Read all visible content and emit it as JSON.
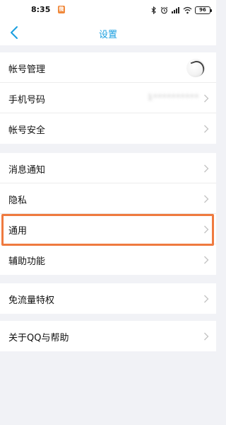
{
  "status_bar": {
    "time": "8:35",
    "app_badge_icon": "notification-app-icon",
    "icons": [
      "bluetooth-icon",
      "alarm-icon",
      "signal-icon",
      "wifi-icon",
      "battery-icon"
    ],
    "battery_level": "96"
  },
  "header": {
    "back_icon": "chevron-left-icon",
    "title": "设置"
  },
  "groups": [
    {
      "items": [
        {
          "label": "帐号管理",
          "trailing": "avatar"
        },
        {
          "label": "手机号码",
          "value": "1**********"
        },
        {
          "label": "帐号安全"
        }
      ]
    },
    {
      "items": [
        {
          "label": "消息通知"
        },
        {
          "label": "隐私"
        },
        {
          "label": "通用",
          "highlighted": true
        },
        {
          "label": "辅助功能"
        }
      ]
    },
    {
      "items": [
        {
          "label": "免流量特权"
        }
      ]
    },
    {
      "items": [
        {
          "label": "关于QQ与帮助"
        }
      ]
    }
  ],
  "colors": {
    "accent": "#1a9fe0",
    "highlight_border": "#ef7a3f",
    "background": "#f1f2f6",
    "chevron": "#c4c4c4"
  }
}
